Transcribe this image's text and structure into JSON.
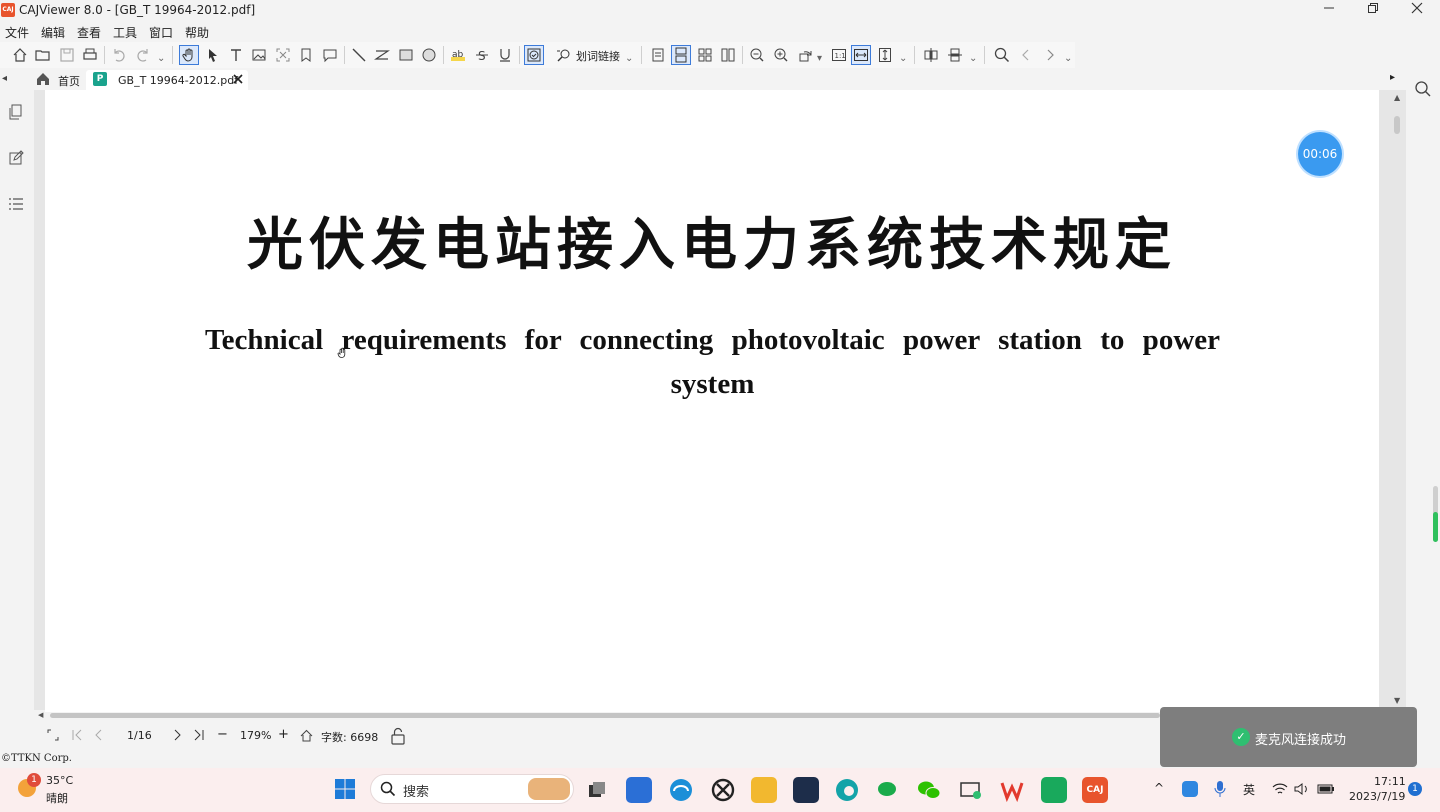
{
  "window": {
    "app_logo": "CAJ",
    "title": "CAJViewer 8.0 - [GB_T 19964-2012.pdf]",
    "minimize_icon": "minimize-icon",
    "maximize_icon": "restore-icon",
    "close_icon": "close-icon"
  },
  "menu": [
    "文件",
    "编辑",
    "查看",
    "工具",
    "窗口",
    "帮助"
  ],
  "toolbar": {
    "word_lookup_label": "划词链接"
  },
  "tabs": {
    "home_label": "首页",
    "doc_icon": "P",
    "doc_label": "GB_T 19964-2012.pdf"
  },
  "document": {
    "title_cn": "光伏发电站接入电力系统技术规定",
    "title_en": "Technical requirements for connecting photovoltaic power station to power system"
  },
  "timer": "00:06",
  "status": {
    "page": "1/16",
    "zoom": "179%",
    "word_count": "字数: 6698"
  },
  "copyright": "©TTKN Corp.",
  "toast": {
    "message": "麦克风连接成功"
  },
  "taskbar": {
    "weather_badge": "1",
    "temperature": "35°C",
    "weather_desc": "晴朗",
    "search_label": "搜索",
    "input_method": "英",
    "time": "17:11",
    "date": "2023/7/19",
    "notification_count": "1"
  },
  "colors": {
    "accent": "#3d7bd9",
    "timer": "#3a9af0",
    "toast_bg": "#7e7e7e",
    "taskbar_bg": "#fbeeee"
  }
}
